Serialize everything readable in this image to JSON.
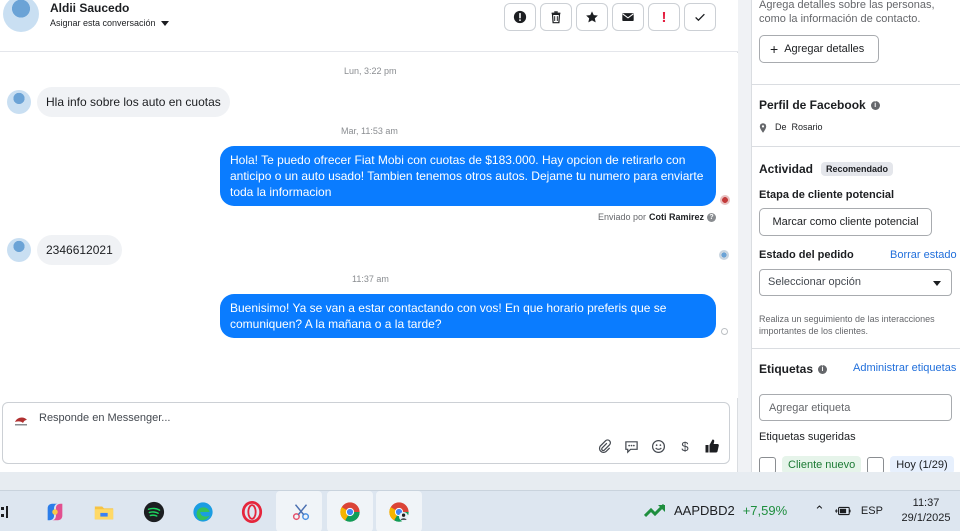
{
  "header": {
    "contact_name": "Aldii Saucedo",
    "assign_label": "Asignar esta conversación"
  },
  "messages": {
    "ts1": "Lun, 3:22 pm",
    "in1": "Hla info sobre los auto en cuotas",
    "ts2": "Mar, 11:53 am",
    "out1": "Hola! Te puedo ofrecer Fiat Mobi con cuotas de $183.000. Hay opcion de retirarlo con anticipo o un auto usado! Tambien tenemos otros autos. Dejame tu numero para enviarte toda la informacion",
    "sent_by_prefix": "Enviado por",
    "sent_by_name": "Coti Ramirez",
    "in2": "2346612021",
    "ts3": "11:37 am",
    "out2": "Buenisimo! Ya se van a estar contactando con vos! En que horario preferis que se comuniquen? A la mañana o a la tarde?"
  },
  "composer": {
    "placeholder": "Responde en Messenger..."
  },
  "side": {
    "intro_text": "Agrega detalles sobre las personas, como la información de contacto.",
    "add_details": "Agregar detalles",
    "fb_profile_title": "Perfil de Facebook",
    "location_prefix": "De",
    "location": "Rosario",
    "activity_title": "Actividad",
    "recommended_badge": "Recomendado",
    "lead_stage_label": "Etapa de cliente potencial",
    "mark_lead_button": "Marcar como cliente potencial",
    "order_status_label": "Estado del pedido",
    "clear_status_link": "Borrar estado",
    "select_placeholder": "Seleccionar opción",
    "tracking_text": "Realiza un seguimiento de las interacciones importantes de los clientes.",
    "tags_title": "Etiquetas",
    "manage_tags_link": "Administrar etiquetas",
    "tag_placeholder": "Agregar etiqueta",
    "suggested_tags_label": "Etiquetas sugeridas",
    "chip_new_client": "Cliente nuevo",
    "chip_today": "Hoy (1/29)"
  },
  "taskbar": {
    "stock_name": "AAPDBD2",
    "stock_change": "+7,59%",
    "language": "ESP",
    "time": "11:37",
    "date": "29/1/2025"
  },
  "colors": {
    "brand_blue": "#0a7cff",
    "link_blue": "#216fdb",
    "danger_red": "#e41e3f",
    "stock_green": "#1e8e3e"
  }
}
